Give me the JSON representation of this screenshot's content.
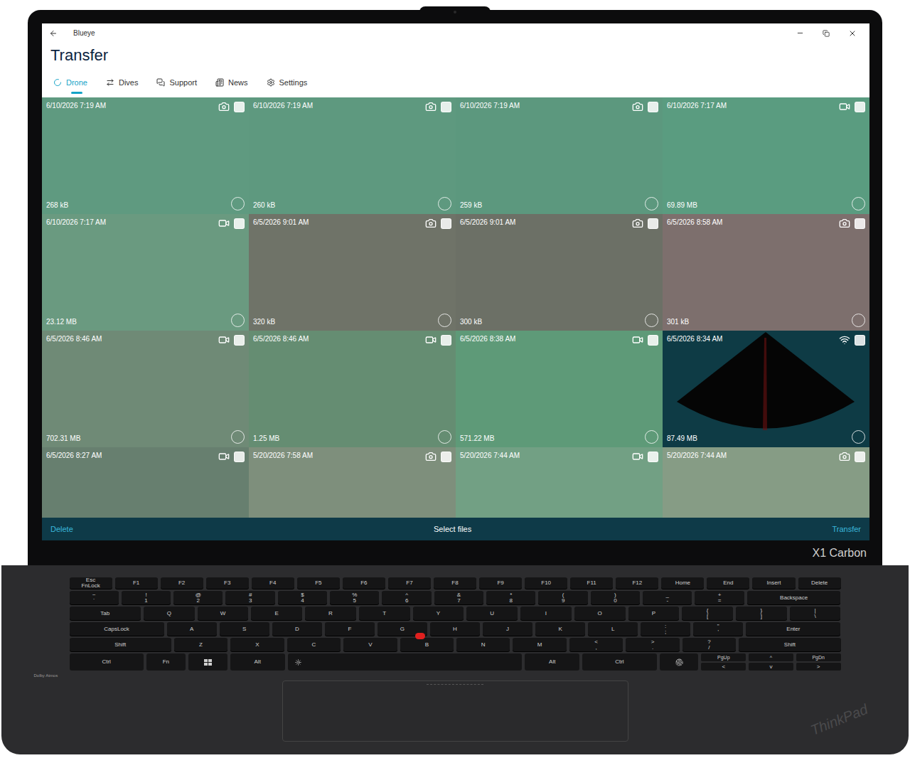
{
  "window": {
    "title": "Blueye"
  },
  "page_title": "Transfer",
  "tabs": [
    {
      "label": "Drone",
      "selected": true
    },
    {
      "label": "Dives",
      "selected": false
    },
    {
      "label": "Support",
      "selected": false
    },
    {
      "label": "News",
      "selected": false
    },
    {
      "label": "Settings",
      "selected": false
    }
  ],
  "files": [
    {
      "date": "6/10/2026 7:19 AM",
      "size": "268 kB",
      "kind": "photo",
      "checked": false,
      "selected": false,
      "color": "#5f9a80"
    },
    {
      "date": "6/10/2026 7:19 AM",
      "size": "260 kB",
      "kind": "photo",
      "checked": false,
      "selected": false,
      "color": "#5e997f"
    },
    {
      "date": "6/10/2026 7:19 AM",
      "size": "259 kB",
      "kind": "photo",
      "checked": false,
      "selected": false,
      "color": "#5c987e"
    },
    {
      "date": "6/10/2026 7:17 AM",
      "size": "69.89 MB",
      "kind": "video",
      "checked": false,
      "selected": false,
      "color": "#5a9c80"
    },
    {
      "date": "6/10/2026 7:17 AM",
      "size": "23.12 MB",
      "kind": "video",
      "checked": false,
      "selected": false,
      "color": "#6a9a80"
    },
    {
      "date": "6/5/2026 9:01 AM",
      "size": "320 kB",
      "kind": "photo",
      "checked": false,
      "selected": false,
      "color": "#6f7368"
    },
    {
      "date": "6/5/2026 9:01 AM",
      "size": "300 kB",
      "kind": "photo",
      "checked": false,
      "selected": false,
      "color": "#6c7066"
    },
    {
      "date": "6/5/2026 8:58 AM",
      "size": "301 kB",
      "kind": "photo",
      "checked": false,
      "selected": false,
      "color": "#7d6f6d"
    },
    {
      "date": "6/5/2026 8:46 AM",
      "size": "702.31 MB",
      "kind": "video",
      "checked": false,
      "selected": false,
      "color": "#6f8a76"
    },
    {
      "date": "6/5/2026 8:46 AM",
      "size": "1.25 MB",
      "kind": "video",
      "checked": false,
      "selected": false,
      "color": "#658d72"
    },
    {
      "date": "6/5/2026 8:38 AM",
      "size": "571.22 MB",
      "kind": "video",
      "checked": false,
      "selected": false,
      "color": "#5e9a78"
    },
    {
      "date": "6/5/2026 8:34 AM",
      "size": "87.49 MB",
      "kind": "sonar",
      "checked": false,
      "selected": false,
      "color": "#0e3b45"
    },
    {
      "date": "6/5/2026 8:27 AM",
      "kind": "video",
      "checked": false,
      "selected": false,
      "color": "#677f6f"
    },
    {
      "date": "5/20/2026 7:58 AM",
      "kind": "photo",
      "checked": false,
      "selected": false,
      "color": "#7e8f7c"
    },
    {
      "date": "5/20/2026 7:44 AM",
      "kind": "video",
      "checked": false,
      "selected": false,
      "color": "#72a084"
    },
    {
      "date": "5/20/2026 7:44 AM",
      "kind": "photo",
      "checked": false,
      "selected": false,
      "color": "#869c85"
    }
  ],
  "action_bar": {
    "delete": "Delete",
    "center": "Select files",
    "transfer": "Transfer"
  },
  "laptop": {
    "model": "X1 Carbon",
    "brand": "ThinkPad",
    "audio": "Dolby Atmos"
  },
  "keyboard": {
    "fn_row": [
      {
        "top": "Esc",
        "label": "FnLock"
      },
      {
        "label": "F1"
      },
      {
        "label": "F2"
      },
      {
        "label": "F3"
      },
      {
        "label": "F4"
      },
      {
        "label": "F5"
      },
      {
        "label": "F6"
      },
      {
        "label": "F7"
      },
      {
        "label": "F8"
      },
      {
        "label": "F9"
      },
      {
        "label": "F10"
      },
      {
        "label": "F11"
      },
      {
        "label": "F12"
      },
      {
        "label": "Home"
      },
      {
        "label": "End"
      },
      {
        "label": "Insert"
      },
      {
        "label": "Delete"
      }
    ],
    "rows": [
      [
        {
          "top": "~",
          "label": "`"
        },
        {
          "top": "!",
          "label": "1"
        },
        {
          "top": "@",
          "label": "2"
        },
        {
          "top": "#",
          "label": "3"
        },
        {
          "top": "$",
          "label": "4"
        },
        {
          "top": "%",
          "label": "5"
        },
        {
          "top": "^",
          "label": "6"
        },
        {
          "top": "&",
          "label": "7"
        },
        {
          "top": "*",
          "label": "8"
        },
        {
          "top": "(",
          "label": "9"
        },
        {
          "top": ")",
          "label": "0"
        },
        {
          "top": "_",
          "label": "-"
        },
        {
          "top": "+",
          "label": "="
        },
        {
          "label": "Backspace"
        }
      ],
      [
        {
          "label": "Tab"
        },
        {
          "label": "Q"
        },
        {
          "label": "W"
        },
        {
          "label": "E"
        },
        {
          "label": "R"
        },
        {
          "label": "T"
        },
        {
          "label": "Y"
        },
        {
          "label": "U"
        },
        {
          "label": "I"
        },
        {
          "label": "O"
        },
        {
          "label": "P"
        },
        {
          "top": "{",
          "label": "["
        },
        {
          "top": "}",
          "label": "]"
        },
        {
          "top": "|",
          "label": "\\"
        }
      ],
      [
        {
          "label": "CapsLock"
        },
        {
          "label": "A"
        },
        {
          "label": "S"
        },
        {
          "label": "D"
        },
        {
          "label": "F"
        },
        {
          "label": "G"
        },
        {
          "label": "H"
        },
        {
          "label": "J"
        },
        {
          "label": "K"
        },
        {
          "label": "L"
        },
        {
          "top": ":",
          "label": ";"
        },
        {
          "top": "\"",
          "label": "'"
        },
        {
          "label": "Enter"
        }
      ],
      [
        {
          "label": "Shift"
        },
        {
          "label": "Z"
        },
        {
          "label": "X"
        },
        {
          "label": "C"
        },
        {
          "label": "V"
        },
        {
          "label": "B"
        },
        {
          "label": "N"
        },
        {
          "label": "M"
        },
        {
          "top": "<",
          "label": ","
        },
        {
          "top": ">",
          "label": "."
        },
        {
          "top": "?",
          "label": "/"
        },
        {
          "label": "Shift"
        }
      ]
    ],
    "bottom_row": [
      {
        "kind": "key",
        "label": "Ctrl"
      },
      {
        "kind": "key",
        "label": "Fn"
      },
      {
        "kind": "win",
        "label": ""
      },
      {
        "kind": "key",
        "label": "Alt"
      },
      {
        "kind": "space",
        "label": ""
      },
      {
        "kind": "key",
        "label": "Alt"
      },
      {
        "kind": "key",
        "label": "Ctrl"
      },
      {
        "kind": "fingerprint",
        "label": ""
      }
    ],
    "arrows": {
      "top": [
        "PgUp",
        "^",
        "PgDn"
      ],
      "bottom": [
        "<",
        "v",
        ">"
      ]
    }
  }
}
